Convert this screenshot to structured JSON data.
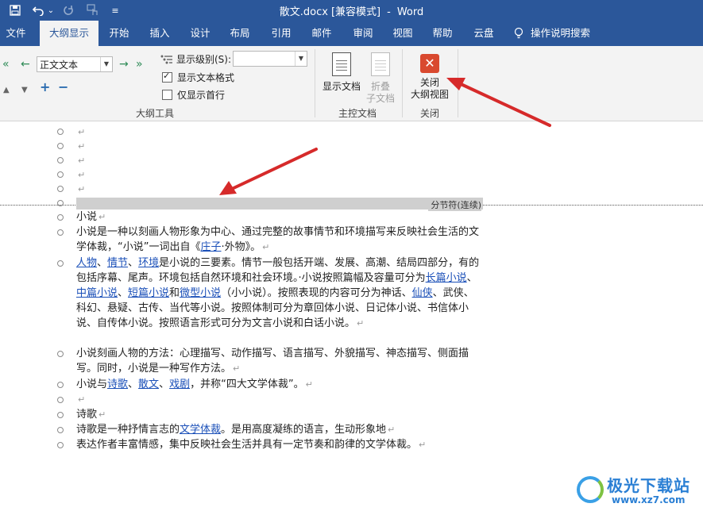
{
  "window": {
    "filename": "散文.docx",
    "mode": "[兼容模式]",
    "separator": "-",
    "app": "Word"
  },
  "qat": {
    "undo_menu_glyph": "⌄",
    "customize_glyph": "≡"
  },
  "tabs": [
    {
      "label": "文件"
    },
    {
      "label": "大纲显示",
      "active": true
    },
    {
      "label": "开始"
    },
    {
      "label": "插入"
    },
    {
      "label": "设计"
    },
    {
      "label": "布局"
    },
    {
      "label": "引用"
    },
    {
      "label": "邮件"
    },
    {
      "label": "审阅"
    },
    {
      "label": "视图"
    },
    {
      "label": "帮助"
    },
    {
      "label": "云盘"
    }
  ],
  "tell_me": "操作说明搜索",
  "ribbon": {
    "outline_tools": {
      "level_combo_value": "正文文本",
      "show_level_label": "显示级别(S):",
      "show_level_value": "",
      "show_text_format_label": "显示文本格式",
      "show_text_format_checked": true,
      "first_line_only_label": "仅显示首行",
      "first_line_only_checked": false,
      "group_label": "大纲工具"
    },
    "master_document": {
      "show_document_label": "显示文档",
      "collapse_label_1": "折叠",
      "collapse_label_2": "子文档",
      "group_label": "主控文档"
    },
    "close": {
      "button_label_1": "关闭",
      "button_label_2": "大纲视图",
      "group_label": "关闭"
    }
  },
  "document": {
    "paragraph_mark": "↵",
    "section_break_label": "分节符(连续)",
    "p1": "小说",
    "p2_a": "小说是一种以刻画人物形象为中心、通过完整的故事情节和环境描写来反映社会生活的文学体裁，“小说”一词出自《",
    "p2_link": "庄子",
    "p2_b": "·外物》。",
    "p3_link1": "人物",
    "p3_link2": "情节",
    "p3_link3": "环境",
    "p3_sep": "、",
    "p3_a": "是小说的三要素。情节一般包括开端、发展、高潮、结局四部分，有的包括序幕、尾声。环境包括自然环境和社会环境。·小说按照篇幅及容量可分为",
    "p3_link4": "长篇小说",
    "p3_link5": "中篇小说",
    "p3_link6": "短篇小说",
    "p3_and": "和",
    "p3_link7": "微型小说",
    "p3_b": "（小小说）。按照表现的内容可分为神话、",
    "p3_link8": "仙侠",
    "p3_c": "、武侠、科幻、悬疑、古传、当代等小说。按照体制可分为章回体小说、日记体小说、书信体小说、自传体小说。按照语言形式可分为文言小说和白话小说。",
    "p4": "小说刻画人物的方法：心理描写、动作描写、语言描写、外貌描写、神态描写、侧面描写。同时，小说是一种写作方法。",
    "p5_a": "小说与",
    "p5_link1": "诗歌",
    "p5_link2": "散文",
    "p5_link3": "戏剧",
    "p5_b": "，并称“四大文学体裁”。",
    "p7": "诗歌",
    "p8_a": "诗歌是一种抒情言志的",
    "p8_link": "文学体裁",
    "p8_b": "。是用高度凝练的语言，生动形象地",
    "p9": "表达作者丰富情感，集中反映社会生活并具有一定节奏和韵律的文学体裁。"
  },
  "watermark": {
    "title": "极光下载站",
    "url": "www.xz7.com"
  },
  "colors": {
    "titlebar": "#2b579a",
    "ribbon": "#f3f3f3",
    "close_button": "#d9492f",
    "link": "#1a4fb8",
    "annotation_arrow": "#d62a2a"
  }
}
